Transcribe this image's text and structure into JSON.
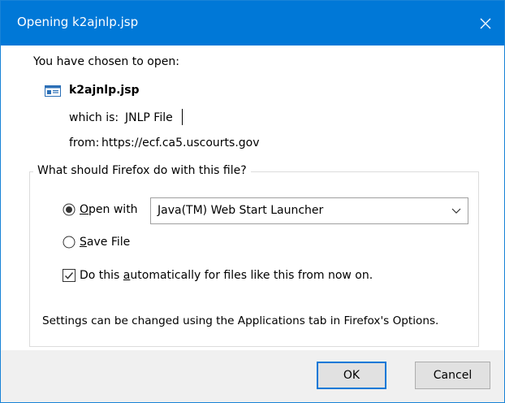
{
  "window": {
    "title": "Opening k2ajnlp.jsp",
    "close_icon": "close-icon"
  },
  "intro": "You have chosen to open:",
  "file": {
    "icon": "jnlp-file-icon",
    "name": "k2ajnlp.jsp",
    "type_label": "which is:",
    "type_value": "JNLP File",
    "from_label": "from:",
    "from_value": "https://ecf.ca5.uscourts.gov"
  },
  "action_group": {
    "legend": "What should Firefox do with this file?",
    "open_with": {
      "mnemonic": "O",
      "rest": "pen with",
      "selected": true
    },
    "app_select": {
      "value": "Java(TM) Web Start Launcher",
      "icon": "chevron-down-icon"
    },
    "save_file": {
      "mnemonic": "S",
      "rest": "ave File",
      "selected": false
    },
    "auto": {
      "pre": "Do this ",
      "mnemonic": "a",
      "rest": "utomatically for files like this from now on.",
      "checked": true
    },
    "settings_note": "Settings can be changed using the Applications tab in Firefox's Options."
  },
  "buttons": {
    "ok": "OK",
    "cancel": "Cancel"
  },
  "colors": {
    "titlebar": "#0078d7",
    "accent": "#0078d7",
    "footer": "#f0f0f0"
  }
}
